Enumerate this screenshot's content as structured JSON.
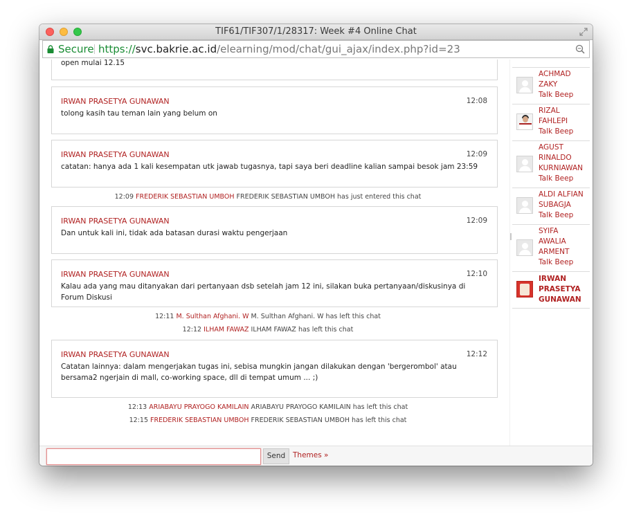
{
  "window": {
    "title": "TIF61/TIF307/1/28317: Week #4 Online Chat",
    "secure_label": "Secure",
    "url_scheme": "https://",
    "url_host": "svc.bakrie.ac.id",
    "url_path": "/elearning/mod/chat/gui_ajax/index.php?id=23"
  },
  "chat": {
    "partial_top_text": "open mulai 12.15",
    "messages": [
      {
        "author": "IRWAN PRASETYA GUNAWAN",
        "time": "12:08",
        "text": "tolong kasih tau teman lain yang belum on"
      },
      {
        "author": "IRWAN PRASETYA GUNAWAN",
        "time": "12:09",
        "text": "catatan: hanya ada 1 kali kesempatan utk jawab tugasnya, tapi saya beri deadline kalian sampai besok jam 23:59"
      },
      {
        "author": "IRWAN PRASETYA GUNAWAN",
        "time": "12:09",
        "text": "Dan untuk kali ini, tidak ada batasan durasi waktu pengerjaan"
      },
      {
        "author": "IRWAN PRASETYA GUNAWAN",
        "time": "12:10",
        "text": "Kalau ada yang mau ditanyakan dari pertanyaan dsb setelah jam 12 ini, silakan buka pertanyaan/diskusinya di Forum Diskusi"
      },
      {
        "author": "IRWAN PRASETYA GUNAWAN",
        "time": "12:12",
        "text": "Catatan lainnya: dalam mengerjakan tugas ini, sebisa mungkin jangan dilakukan dengan 'bergerombol' atau bersama2 ngerjain di mall, co-working space, dll di tempat umum ... ;)"
      }
    ],
    "system": [
      {
        "time": "12:09",
        "user": "FREDERIK SEBASTIAN UMBOH",
        "text": "FREDERIK SEBASTIAN UMBOH has just entered this chat"
      },
      {
        "time": "12:11",
        "user": "M. Sulthan Afghani. W",
        "text": "M. Sulthan Afghani. W has left this chat"
      },
      {
        "time": "12:12",
        "user": "ILHAM FAWAZ",
        "text": "ILHAM FAWAZ has left this chat"
      },
      {
        "time": "12:13",
        "user": "ARIABAYU PRAYOGO KAMILAIN",
        "text": "ARIABAYU PRAYOGO KAMILAIN has left this chat"
      },
      {
        "time": "12:15",
        "user": "FREDERIK SEBASTIAN UMBOH",
        "text": "FREDERIK SEBASTIAN UMBOH has left this chat"
      }
    ]
  },
  "users": [
    {
      "name_lines": [
        "ACHMAD",
        "ZAKY"
      ],
      "beep": "Talk Beep"
    },
    {
      "name_lines": [
        "RIZAL",
        "FAHLEPI"
      ],
      "beep": "Talk Beep"
    },
    {
      "name_lines": [
        "AGUST",
        "RINALDO",
        "KURNIAWAN"
      ],
      "beep": "Talk Beep"
    },
    {
      "name_lines": [
        "ALDI ALFIAN",
        "SUBAGJA"
      ],
      "beep": "Talk Beep"
    },
    {
      "name_lines": [
        "SYIFA",
        "AWALIA",
        "ARMENT"
      ],
      "beep": "Talk Beep"
    },
    {
      "name_lines": [
        "IRWAN",
        "PRASETYA",
        "GUNAWAN"
      ]
    }
  ],
  "input": {
    "value": "",
    "placeholder": ""
  },
  "buttons": {
    "send": "Send",
    "themes": "Themes »"
  },
  "colors": {
    "accent": "#b02121",
    "secure": "#1a8c34"
  }
}
